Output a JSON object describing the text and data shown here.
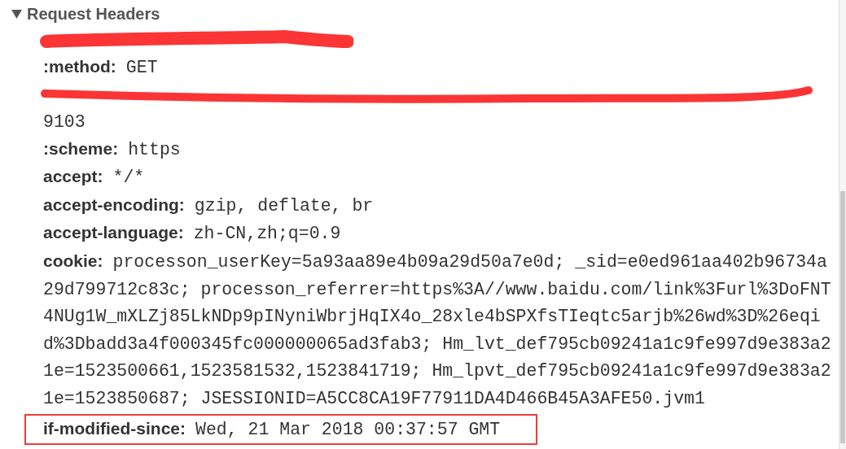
{
  "panel": {
    "title": "Request Headers",
    "expanded": true,
    "headers": [
      {
        "kind": "redacted"
      },
      {
        "kind": "header",
        "name": ":method:",
        "value": "GET",
        "highlighted": false
      },
      {
        "kind": "redacted",
        "continuation": "9103"
      },
      {
        "kind": "header",
        "name": ":scheme:",
        "value": "https",
        "highlighted": false
      },
      {
        "kind": "header",
        "name": "accept:",
        "value": "*/*",
        "highlighted": false
      },
      {
        "kind": "header",
        "name": "accept-encoding:",
        "value": "gzip, deflate, br",
        "highlighted": false
      },
      {
        "kind": "header",
        "name": "accept-language:",
        "value": "zh-CN,zh;q=0.9",
        "highlighted": false
      },
      {
        "kind": "header",
        "name": "cookie:",
        "value": "processon_userKey=5a93aa89e4b09a29d50a7e0d; _sid=e0ed961aa402b96734a29d799712c83c; processon_referrer=https%3A//www.baidu.com/link%3Furl%3DoFNT4NUg1W_mXLZj85LkNDp9pINyniWbrjHqIX4o_28xle4bSPXfsTIeqtc5arjb%26wd%3D%26eqid%3Dbadd3a4f000345fc000000065ad3fab3; Hm_lvt_def795cb09241a1c9fe997d9e383a21e=1523500661,1523581532,1523841719; Hm_lpvt_def795cb09241a1c9fe997d9e383a21e=1523850687; JSESSIONID=A5CC8CA19F77911DA4D466B45A3AFE50.jvm1",
        "highlighted": false
      },
      {
        "kind": "header",
        "name": "if-modified-since:",
        "value": "Wed, 21 Mar 2018 00:37:57 GMT",
        "highlighted": true
      }
    ]
  }
}
